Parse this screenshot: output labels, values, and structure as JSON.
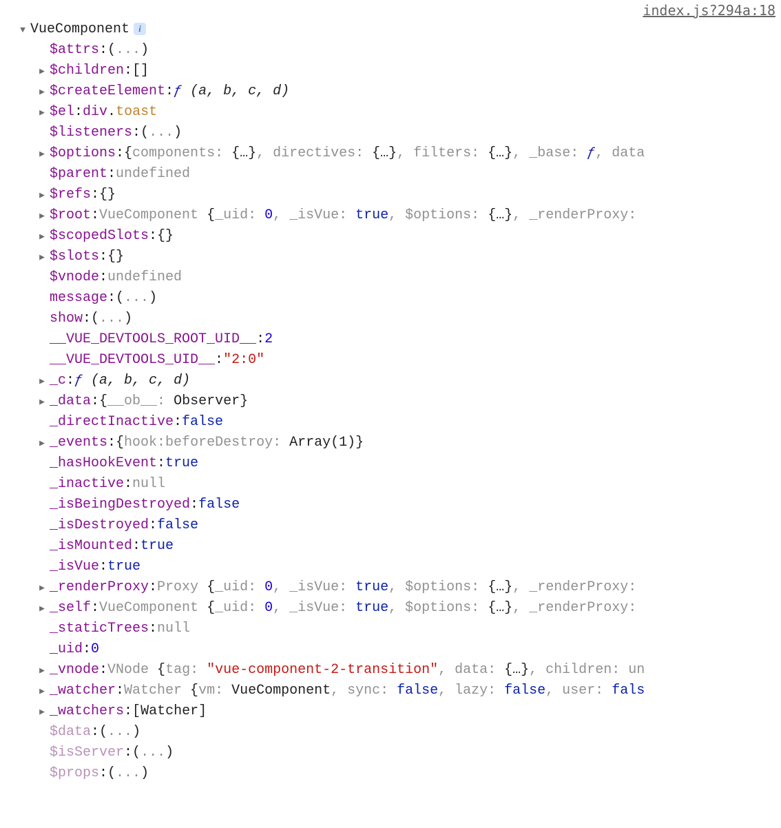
{
  "source_link": "index.js?294a:18",
  "root": {
    "label": "VueComponent",
    "arrow": "down"
  },
  "rows": [
    {
      "arrow": "none",
      "key": "$attrs",
      "value": [
        {
          "t": "punct",
          "v": "("
        },
        {
          "t": "dim",
          "v": "..."
        },
        {
          "t": "punct",
          "v": ")"
        }
      ]
    },
    {
      "arrow": "right",
      "key": "$children",
      "value": [
        {
          "t": "punct",
          "v": "[]"
        }
      ]
    },
    {
      "arrow": "right",
      "key": "$createElement",
      "value": [
        {
          "t": "func-f",
          "v": "ƒ "
        },
        {
          "t": "func-args",
          "v": "(a, b, c, d)"
        }
      ]
    },
    {
      "arrow": "right",
      "key": "$el",
      "value": [
        {
          "t": "tag",
          "v": "div"
        },
        {
          "t": "punct",
          "v": "."
        },
        {
          "t": "cls",
          "v": "toast"
        }
      ]
    },
    {
      "arrow": "none",
      "key": "$listeners",
      "value": [
        {
          "t": "punct",
          "v": "("
        },
        {
          "t": "dim",
          "v": "..."
        },
        {
          "t": "punct",
          "v": ")"
        }
      ]
    },
    {
      "arrow": "right",
      "key": "$options",
      "value": [
        {
          "t": "punct",
          "v": "{"
        },
        {
          "t": "dim",
          "v": "components: "
        },
        {
          "t": "punct",
          "v": "{…}"
        },
        {
          "t": "dim",
          "v": ", directives: "
        },
        {
          "t": "punct",
          "v": "{…}"
        },
        {
          "t": "dim",
          "v": ", filters: "
        },
        {
          "t": "punct",
          "v": "{…}"
        },
        {
          "t": "dim",
          "v": ", _base: "
        },
        {
          "t": "func-f",
          "v": "ƒ"
        },
        {
          "t": "dim",
          "v": ", data"
        }
      ]
    },
    {
      "arrow": "none",
      "key": "$parent",
      "value": [
        {
          "t": "dim",
          "v": "undefined"
        }
      ]
    },
    {
      "arrow": "right",
      "key": "$refs",
      "value": [
        {
          "t": "punct",
          "v": "{}"
        }
      ]
    },
    {
      "arrow": "right",
      "key": "$root",
      "value": [
        {
          "t": "dim",
          "v": "VueComponent "
        },
        {
          "t": "punct",
          "v": "{"
        },
        {
          "t": "dim",
          "v": "_uid: "
        },
        {
          "t": "num",
          "v": "0"
        },
        {
          "t": "dim",
          "v": ", _isVue: "
        },
        {
          "t": "bool",
          "v": "true"
        },
        {
          "t": "dim",
          "v": ", $options: "
        },
        {
          "t": "punct",
          "v": "{…}"
        },
        {
          "t": "dim",
          "v": ", _renderProxy:"
        }
      ]
    },
    {
      "arrow": "right",
      "key": "$scopedSlots",
      "value": [
        {
          "t": "punct",
          "v": "{}"
        }
      ]
    },
    {
      "arrow": "right",
      "key": "$slots",
      "value": [
        {
          "t": "punct",
          "v": "{}"
        }
      ]
    },
    {
      "arrow": "none",
      "key": "$vnode",
      "value": [
        {
          "t": "dim",
          "v": "undefined"
        }
      ]
    },
    {
      "arrow": "none",
      "key": "message",
      "value": [
        {
          "t": "punct",
          "v": "("
        },
        {
          "t": "dim",
          "v": "..."
        },
        {
          "t": "punct",
          "v": ")"
        }
      ]
    },
    {
      "arrow": "none",
      "key": "show",
      "value": [
        {
          "t": "punct",
          "v": "("
        },
        {
          "t": "dim",
          "v": "..."
        },
        {
          "t": "punct",
          "v": ")"
        }
      ]
    },
    {
      "arrow": "none",
      "key": "__VUE_DEVTOOLS_ROOT_UID__",
      "value": [
        {
          "t": "num",
          "v": "2"
        }
      ]
    },
    {
      "arrow": "none",
      "key": "__VUE_DEVTOOLS_UID__",
      "value": [
        {
          "t": "str",
          "v": "\"2:0\""
        }
      ]
    },
    {
      "arrow": "right",
      "key": "_c",
      "value": [
        {
          "t": "func-f",
          "v": "ƒ "
        },
        {
          "t": "func-args",
          "v": "(a, b, c, d)"
        }
      ]
    },
    {
      "arrow": "right",
      "key": "_data",
      "value": [
        {
          "t": "punct",
          "v": "{"
        },
        {
          "t": "dim",
          "v": "__ob__: "
        },
        {
          "t": "type-name",
          "v": "Observer"
        },
        {
          "t": "punct",
          "v": "}"
        }
      ]
    },
    {
      "arrow": "none",
      "key": "_directInactive",
      "value": [
        {
          "t": "bool",
          "v": "false"
        }
      ]
    },
    {
      "arrow": "right",
      "key": "_events",
      "value": [
        {
          "t": "punct",
          "v": "{"
        },
        {
          "t": "dim",
          "v": "hook:beforeDestroy: "
        },
        {
          "t": "type-name",
          "v": "Array(1)"
        },
        {
          "t": "punct",
          "v": "}"
        }
      ]
    },
    {
      "arrow": "none",
      "key": "_hasHookEvent",
      "value": [
        {
          "t": "bool",
          "v": "true"
        }
      ]
    },
    {
      "arrow": "none",
      "key": "_inactive",
      "value": [
        {
          "t": "dim",
          "v": "null"
        }
      ]
    },
    {
      "arrow": "none",
      "key": "_isBeingDestroyed",
      "value": [
        {
          "t": "bool",
          "v": "false"
        }
      ]
    },
    {
      "arrow": "none",
      "key": "_isDestroyed",
      "value": [
        {
          "t": "bool",
          "v": "false"
        }
      ]
    },
    {
      "arrow": "none",
      "key": "_isMounted",
      "value": [
        {
          "t": "bool",
          "v": "true"
        }
      ]
    },
    {
      "arrow": "none",
      "key": "_isVue",
      "value": [
        {
          "t": "bool",
          "v": "true"
        }
      ]
    },
    {
      "arrow": "right",
      "key": "_renderProxy",
      "value": [
        {
          "t": "dim",
          "v": "Proxy "
        },
        {
          "t": "punct",
          "v": "{"
        },
        {
          "t": "dim",
          "v": "_uid: "
        },
        {
          "t": "num",
          "v": "0"
        },
        {
          "t": "dim",
          "v": ", _isVue: "
        },
        {
          "t": "bool",
          "v": "true"
        },
        {
          "t": "dim",
          "v": ", $options: "
        },
        {
          "t": "punct",
          "v": "{…}"
        },
        {
          "t": "dim",
          "v": ", _renderProxy:"
        }
      ]
    },
    {
      "arrow": "right",
      "key": "_self",
      "value": [
        {
          "t": "dim",
          "v": "VueComponent "
        },
        {
          "t": "punct",
          "v": "{"
        },
        {
          "t": "dim",
          "v": "_uid: "
        },
        {
          "t": "num",
          "v": "0"
        },
        {
          "t": "dim",
          "v": ", _isVue: "
        },
        {
          "t": "bool",
          "v": "true"
        },
        {
          "t": "dim",
          "v": ", $options: "
        },
        {
          "t": "punct",
          "v": "{…}"
        },
        {
          "t": "dim",
          "v": ", _renderProxy:"
        }
      ]
    },
    {
      "arrow": "none",
      "key": "_staticTrees",
      "value": [
        {
          "t": "dim",
          "v": "null"
        }
      ]
    },
    {
      "arrow": "none",
      "key": "_uid",
      "value": [
        {
          "t": "num",
          "v": "0"
        }
      ]
    },
    {
      "arrow": "right",
      "key": "_vnode",
      "value": [
        {
          "t": "dim",
          "v": "VNode "
        },
        {
          "t": "punct",
          "v": "{"
        },
        {
          "t": "dim",
          "v": "tag: "
        },
        {
          "t": "str",
          "v": "\"vue-component-2-transition\""
        },
        {
          "t": "dim",
          "v": ", data: "
        },
        {
          "t": "punct",
          "v": "{…}"
        },
        {
          "t": "dim",
          "v": ", children: un"
        }
      ]
    },
    {
      "arrow": "right",
      "key": "_watcher",
      "value": [
        {
          "t": "dim",
          "v": "Watcher "
        },
        {
          "t": "punct",
          "v": "{"
        },
        {
          "t": "dim",
          "v": "vm: "
        },
        {
          "t": "type-name",
          "v": "VueComponent"
        },
        {
          "t": "dim",
          "v": ", sync: "
        },
        {
          "t": "bool",
          "v": "false"
        },
        {
          "t": "dim",
          "v": ", lazy: "
        },
        {
          "t": "bool",
          "v": "false"
        },
        {
          "t": "dim",
          "v": ", user: "
        },
        {
          "t": "bool",
          "v": "fals"
        }
      ]
    },
    {
      "arrow": "right",
      "key": "_watchers",
      "value": [
        {
          "t": "punct",
          "v": "["
        },
        {
          "t": "type-name",
          "v": "Watcher"
        },
        {
          "t": "punct",
          "v": "]"
        }
      ]
    },
    {
      "arrow": "none",
      "faded": true,
      "key": "$data",
      "value": [
        {
          "t": "punct",
          "v": "("
        },
        {
          "t": "dim",
          "v": "..."
        },
        {
          "t": "punct",
          "v": ")"
        }
      ]
    },
    {
      "arrow": "none",
      "faded": true,
      "key": "$isServer",
      "value": [
        {
          "t": "punct",
          "v": "("
        },
        {
          "t": "dim",
          "v": "..."
        },
        {
          "t": "punct",
          "v": ")"
        }
      ]
    },
    {
      "arrow": "none",
      "faded": true,
      "key": "$props",
      "value": [
        {
          "t": "punct",
          "v": "("
        },
        {
          "t": "dim",
          "v": "..."
        },
        {
          "t": "punct",
          "v": ")"
        }
      ]
    }
  ]
}
